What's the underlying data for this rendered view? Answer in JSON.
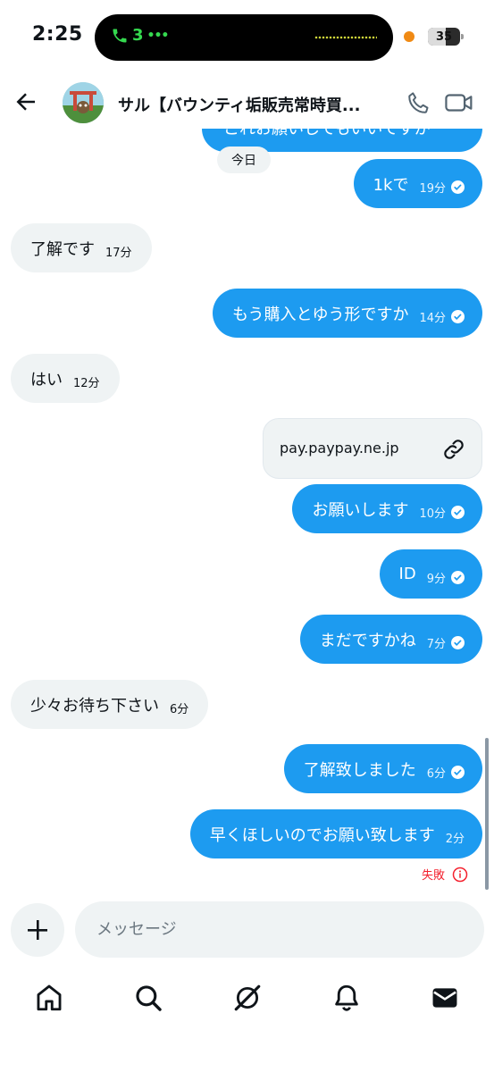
{
  "status_bar": {
    "time": "2:25",
    "call_count": "3",
    "battery": "35"
  },
  "header": {
    "title": "サル【バウンティ垢販売常時買...",
    "back_icon": "arrow-left-icon",
    "phone_icon": "phone-icon",
    "video_icon": "video-camera-icon"
  },
  "conversation": {
    "partial_top_message": "これお願いしてもいいですか",
    "date_divider": "今日",
    "messages": [
      {
        "side": "out",
        "text": "1kで",
        "time": "19分",
        "read": true
      },
      {
        "side": "in",
        "text": "了解です",
        "time": "17分"
      },
      {
        "side": "out",
        "text": "もう購入とゆう形ですか",
        "time": "14分",
        "read": true
      },
      {
        "side": "in",
        "text": "はい",
        "time": "12分"
      },
      {
        "side": "out",
        "text": "お願いします",
        "time": "10分",
        "read": true
      },
      {
        "side": "out",
        "text": "ID",
        "time": "9分",
        "read": true
      },
      {
        "side": "out",
        "text": "まだですかね",
        "time": "7分",
        "read": true
      },
      {
        "side": "in",
        "text": "少々お待ち下さい",
        "time": "6分"
      },
      {
        "side": "out",
        "text": "了解致しました",
        "time": "6分",
        "read": true
      },
      {
        "side": "out",
        "text": "早くほしいのでお願い致します",
        "time": "2分",
        "read": false
      }
    ],
    "link_card": {
      "text": "pay.paypay.ne.jp",
      "icon": "link-icon"
    },
    "failed_label": "失敗",
    "failed_icon": "info-circle-icon"
  },
  "composer": {
    "placeholder": "メッセージ",
    "add_icon": "plus-icon"
  },
  "bottom_nav": [
    {
      "name": "home",
      "icon": "home-icon"
    },
    {
      "name": "search",
      "icon": "search-icon"
    },
    {
      "name": "grok",
      "icon": "grok-icon"
    },
    {
      "name": "notifications",
      "icon": "bell-icon"
    },
    {
      "name": "messages",
      "icon": "envelope-icon"
    }
  ],
  "colors": {
    "outgoing_bubble": "#1d9bf0",
    "incoming_bubble": "#eff3f4",
    "failed": "#f4212e"
  }
}
